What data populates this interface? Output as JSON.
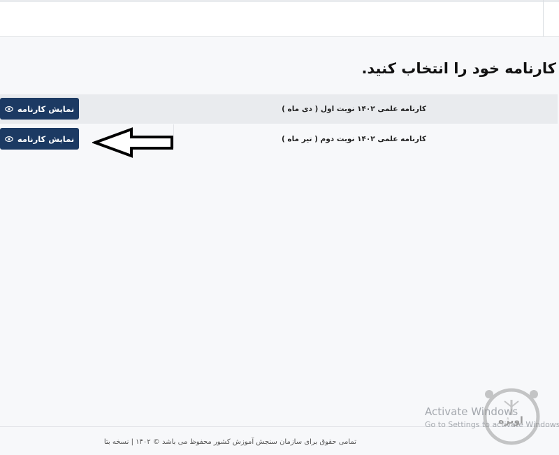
{
  "header": {},
  "page": {
    "title": "کارنامه خود را انتخاب کنید."
  },
  "report_cards": [
    {
      "label": "کارنامه علمی ۱۴۰۲ نوبت اول ( دی ماه )",
      "button_label": "نمایش کارنامه"
    },
    {
      "label": "کارنامه علمی ۱۴۰۲ نوبت دوم ( تیر ماه )",
      "button_label": "نمایش کارنامه"
    }
  ],
  "footer": {
    "text": "تمامی حقوق برای سازمان سنجش آموزش کشور محفوظ می باشد © ۱۴۰۲ | نسخه بتا"
  },
  "overlay": {
    "activate_title": "Activate Windows",
    "activate_subtitle": "Go to Settings to activate Windows.",
    "watermark_text": "اویژه"
  },
  "colors": {
    "button_bg": "#1c3a63",
    "row_alt_bg": "#e9ebee",
    "page_bg": "#f7f8fa"
  },
  "icons": {
    "button_icon": "eye-icon",
    "annotation": "arrow-left-icon"
  }
}
